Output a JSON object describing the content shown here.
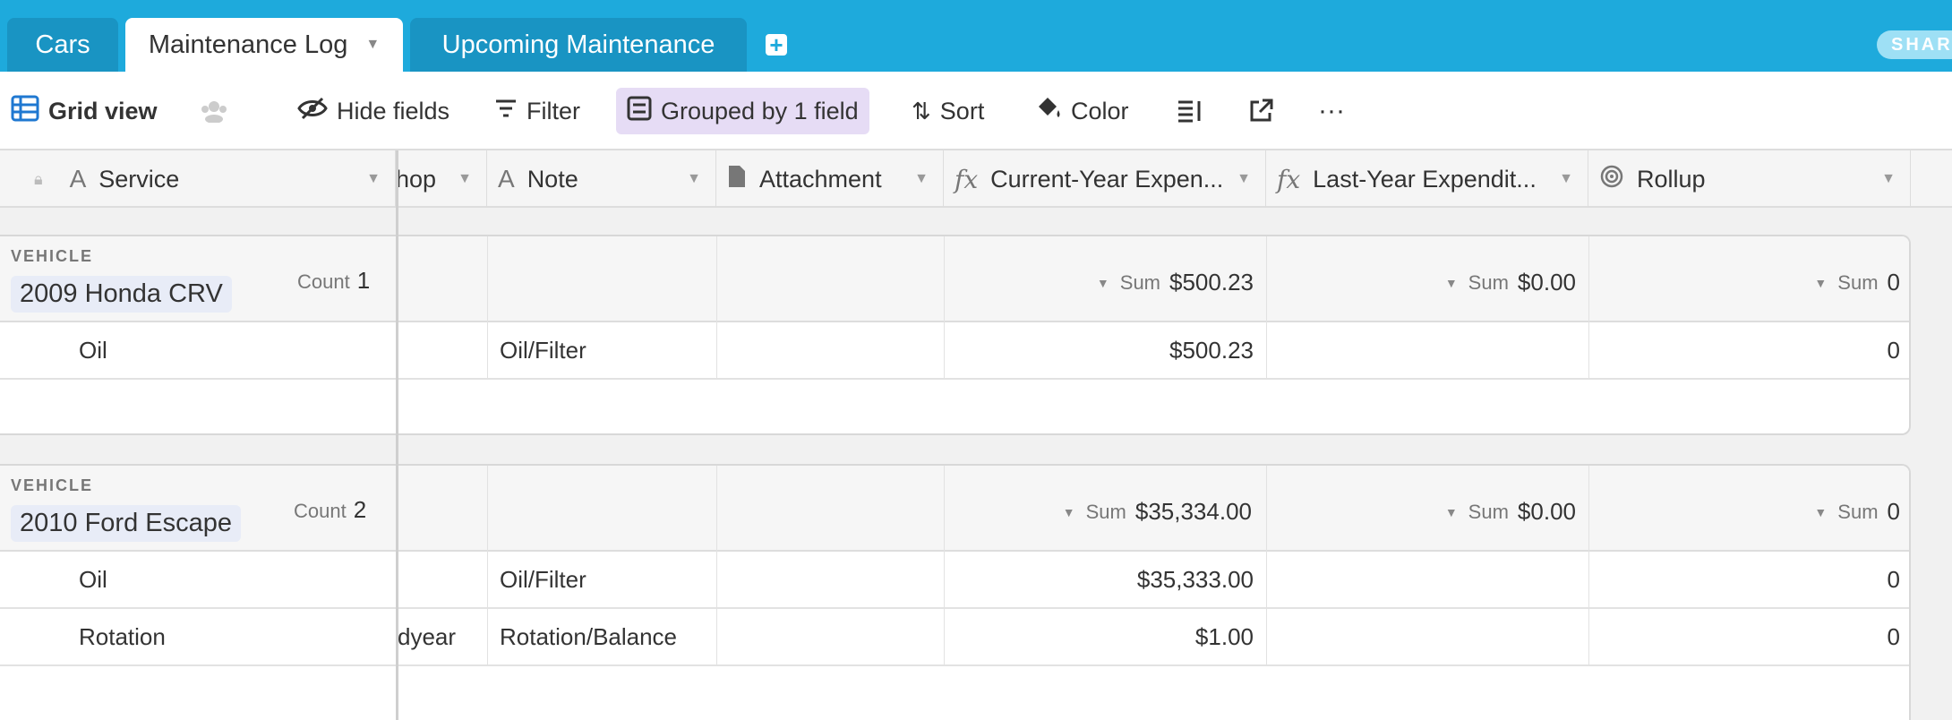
{
  "tabs": [
    {
      "label": "Cars"
    },
    {
      "label": "Maintenance Log"
    },
    {
      "label": "Upcoming Maintenance"
    }
  ],
  "share_label": "SHAR",
  "toolbar": {
    "view_name": "Grid view",
    "hide_fields": "Hide fields",
    "filter": "Filter",
    "grouped": "Grouped by 1 field",
    "sort": "Sort",
    "color": "Color"
  },
  "columns": {
    "service": "Service",
    "shop": "hop",
    "note": "Note",
    "attachment": "Attachment",
    "current_year": "Current-Year Expen...",
    "last_year": "Last-Year Expendit...",
    "rollup": "Rollup"
  },
  "groups": [
    {
      "label": "VEHICLE",
      "name": "2009 Honda CRV",
      "count_label": "Count",
      "count": "1",
      "sum_label": "Sum",
      "sum_current": "$500.23",
      "sum_last": "$0.00",
      "sum_rollup": "0",
      "rows": [
        {
          "service": "Oil",
          "shop": "",
          "note": "Oil/Filter",
          "current": "$500.23",
          "rollup": "0"
        }
      ]
    },
    {
      "label": "VEHICLE",
      "name": "2010 Ford Escape",
      "count_label": "Count",
      "count": "2",
      "sum_label": "Sum",
      "sum_current": "$35,334.00",
      "sum_last": "$0.00",
      "sum_rollup": "0",
      "rows": [
        {
          "service": "Oil",
          "shop": "",
          "note": "Oil/Filter",
          "current": "$35,333.00",
          "rollup": "0"
        },
        {
          "service": "Rotation",
          "shop": "dyear",
          "note": "Rotation/Balance",
          "current": "$1.00",
          "rollup": "0"
        }
      ]
    }
  ]
}
